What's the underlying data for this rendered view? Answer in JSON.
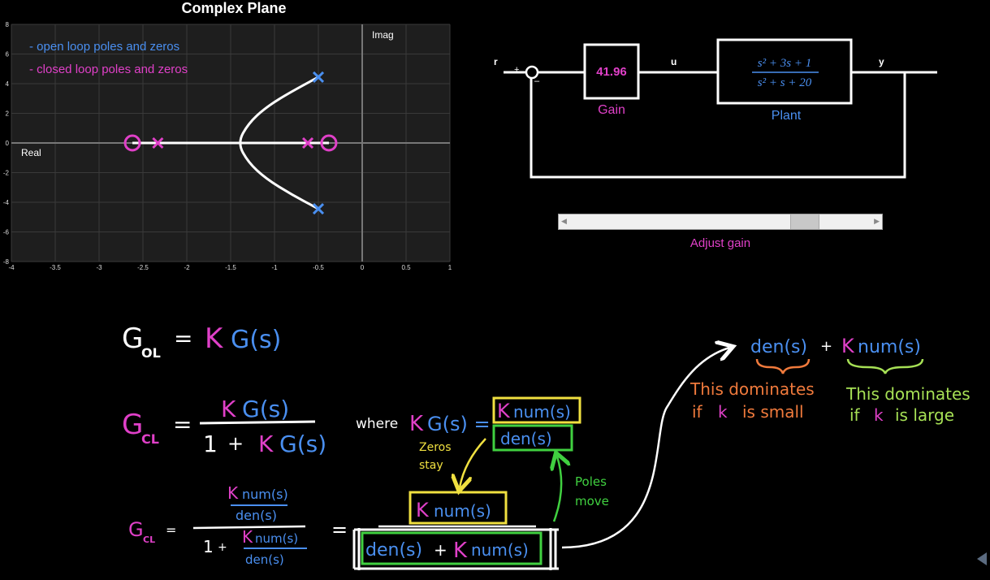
{
  "colors": {
    "magenta": "#e040c8",
    "blue": "#4a8ff0",
    "yellow": "#f0e040",
    "green": "#40d040",
    "orange": "#f07a3c",
    "light_green": "#a6e055",
    "plot_bg": "#1e1e1e"
  },
  "chart_data": {
    "type": "scatter",
    "title": "Complex Plane",
    "xlabel": "Real",
    "ylabel": "Imag",
    "xlim": [
      -4,
      1
    ],
    "ylim": [
      -8,
      8
    ],
    "xticks": [
      "-4",
      "-3.5",
      "-3",
      "-2.5",
      "-2",
      "-1.5",
      "-1",
      "-0.5",
      "0",
      "0.5",
      "1"
    ],
    "yticks": [
      "8",
      "6",
      "4",
      "2",
      "0",
      "-2",
      "-4",
      "-6",
      "-8"
    ],
    "grid": true,
    "legend": [
      {
        "label": "- open loop poles and zeros",
        "color": "#4a8ff0"
      },
      {
        "label": "- closed loop poles and zeros",
        "color": "#e040c8"
      }
    ],
    "series": [
      {
        "name": "open loop poles",
        "marker": "x",
        "color": "#4a8ff0",
        "points": [
          [
            -0.5,
            4.44
          ],
          [
            -0.5,
            -4.44
          ]
        ]
      },
      {
        "name": "closed loop poles",
        "marker": "x",
        "color": "#e040c8",
        "points": [
          [
            -2.33,
            0
          ],
          [
            -0.62,
            0
          ]
        ]
      },
      {
        "name": "zeros",
        "marker": "o",
        "color": "#e040c8",
        "points": [
          [
            -2.62,
            0
          ],
          [
            -0.38,
            0
          ]
        ]
      }
    ],
    "root_locus": {
      "color": "#ffffff",
      "branch_points": [
        [
          -0.5,
          4.44
        ],
        [
          -0.8,
          3.5
        ],
        [
          -1.1,
          2.4
        ],
        [
          -1.3,
          1.3
        ],
        [
          -1.42,
          0
        ],
        [
          -1.3,
          -1.3
        ],
        [
          -1.1,
          -2.4
        ],
        [
          -0.8,
          -3.5
        ],
        [
          -0.5,
          -4.44
        ]
      ],
      "real_segments": [
        [
          -2.62,
          -0.62
        ],
        [
          -0.62,
          -0.38
        ]
      ]
    }
  },
  "block_diagram": {
    "r_label": "r",
    "plus_label": "+",
    "minus_label": "–",
    "u_label": "u",
    "y_label": "y",
    "gain_value": "41.96",
    "gain_label": "Gain",
    "plant_num": "s² + 3s + 1",
    "plant_den": "s² + s + 20",
    "plant_label": "Plant"
  },
  "slider": {
    "label": "Adjust gain",
    "position": 0.78
  },
  "notes": {
    "g_ol_lhs": "G",
    "g_ol_sub": "OL",
    "eq": "=",
    "g_ol_k": "K",
    "g_ol_gs": "G(s)",
    "g_cl_lhs": "G",
    "g_cl_sub": "CL",
    "cl_num_k": "K",
    "cl_num_gs": "G(s)",
    "cl_den_one": "1",
    "cl_den_plus": "+",
    "cl_den_k": "K",
    "cl_den_gs": "G(s)",
    "where": "where",
    "where_k": "K",
    "where_gs": "G(s) =",
    "box_k": "K",
    "box_num": "num(s)",
    "box_den": "den(s)",
    "zeros_stay_1": "Zeros",
    "zeros_stay_2": "stay",
    "poles_move_1": "Poles",
    "poles_move_2": "move",
    "third_lhs": "G",
    "third_sub": "CL",
    "third_eq": "=",
    "inner_k": "K",
    "inner_num": "num(s)",
    "inner_den": "den(s)",
    "inner_one": "1",
    "inner_plus": "+",
    "inner_k2": "K",
    "inner_num2": "num(s)",
    "inner_den2": "den(s)",
    "eq2": "=",
    "yellow_k": "K",
    "yellow_num": "num(s)",
    "green_den": "den(s)",
    "green_plus": "+",
    "green_k": "K",
    "green_num": "num(s)",
    "top_den": "den(s)",
    "top_plus": "+",
    "top_k": "K",
    "top_num": "num(s)",
    "dom_small_1": "This dominates",
    "dom_small_2a": "if",
    "dom_small_2k": "k",
    "dom_small_2b": "is small",
    "dom_large_1": "This dominates",
    "dom_large_2a": "if",
    "dom_large_2k": "k",
    "dom_large_2b": "is large"
  }
}
